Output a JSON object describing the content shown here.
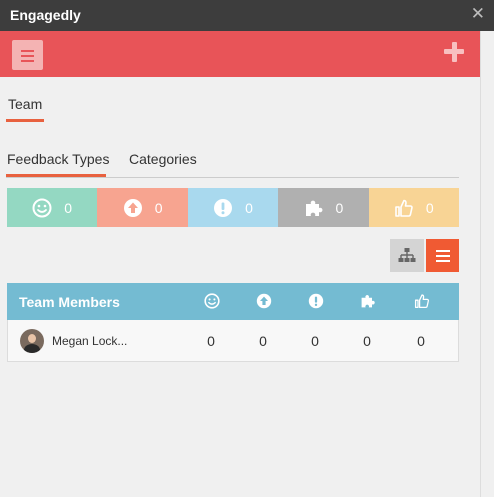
{
  "window": {
    "title": "Engagedly",
    "close_icon": "close-icon"
  },
  "colors": {
    "titlebar": "#3d3d3d",
    "topbar": "#e85458",
    "accent": "#e8613f",
    "smile": "#94d8c2",
    "arrow_up": "#f7a490",
    "exclamation": "#a9d9ee",
    "puzzle": "#b0b0b0",
    "thumbs_up": "#f8d495",
    "table_header": "#74bbd2"
  },
  "topbar": {
    "menu_icon": "hamburger-menu-icon",
    "add_icon": "plus-icon"
  },
  "nav": {
    "team_tab": "Team"
  },
  "tabs": [
    {
      "label": "Feedback Types",
      "active": true
    },
    {
      "label": "Categories",
      "active": false
    }
  ],
  "stats": [
    {
      "icon": "smile-icon",
      "value": "0"
    },
    {
      "icon": "arrow-up-circle-icon",
      "value": "0"
    },
    {
      "icon": "exclamation-circle-icon",
      "value": "0"
    },
    {
      "icon": "puzzle-icon",
      "value": "0"
    },
    {
      "icon": "thumbs-up-icon",
      "value": "0"
    }
  ],
  "view_toggle": {
    "org_icon": "org-chart-icon",
    "list_icon": "list-icon",
    "active": "list"
  },
  "table": {
    "header": "Team Members",
    "columns": [
      "smile-icon",
      "arrow-up-circle-icon",
      "exclamation-circle-icon",
      "puzzle-icon",
      "thumbs-up-icon"
    ],
    "rows": [
      {
        "name": "Megan Lock...",
        "values": [
          "0",
          "0",
          "0",
          "0",
          "0"
        ]
      }
    ]
  }
}
